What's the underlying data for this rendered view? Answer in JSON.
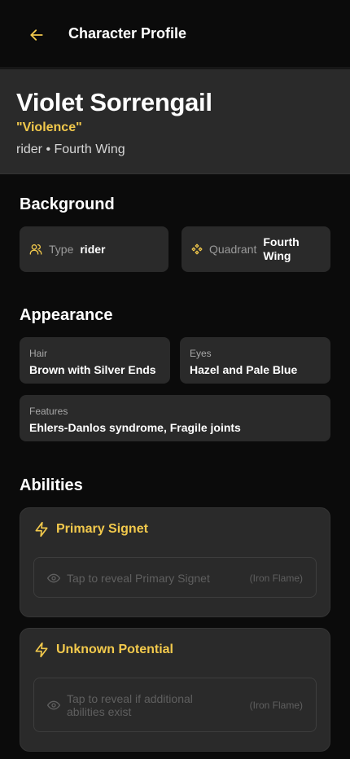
{
  "header": {
    "title": "Character Profile",
    "back_icon": "arrow-left-icon"
  },
  "character": {
    "name": "Violet Sorrengail",
    "nickname": "\"Violence\"",
    "subtitle": "rider • Fourth Wing"
  },
  "background": {
    "section_title": "Background",
    "type": {
      "label": "Type",
      "value": "rider",
      "icon": "users-icon"
    },
    "quadrant": {
      "label": "Quadrant",
      "value_line1": "Fourth",
      "value_line2": "Wing",
      "icon": "quadrant-icon"
    }
  },
  "appearance": {
    "section_title": "Appearance",
    "hair": {
      "label": "Hair",
      "value": "Brown with Silver Ends"
    },
    "eyes": {
      "label": "Eyes",
      "value": "Hazel and Pale Blue"
    },
    "features": {
      "label": "Features",
      "value": "Ehlers-Danlos syndrome, Fragile joints"
    }
  },
  "abilities": {
    "section_title": "Abilities",
    "items": [
      {
        "title": "Primary Signet",
        "icon": "lightning-icon",
        "reveal_text": "Tap to reveal Primary Signet",
        "source": "(Iron Flame)"
      },
      {
        "title": "Unknown Potential",
        "icon": "lightning-icon",
        "reveal_line1": "Tap to reveal if additional",
        "reveal_line2": "abilities exist",
        "source": "(Iron Flame)"
      }
    ]
  },
  "colors": {
    "accent": "#f2c94c",
    "card": "#2a2a2a",
    "background": "#0b0b0b"
  }
}
